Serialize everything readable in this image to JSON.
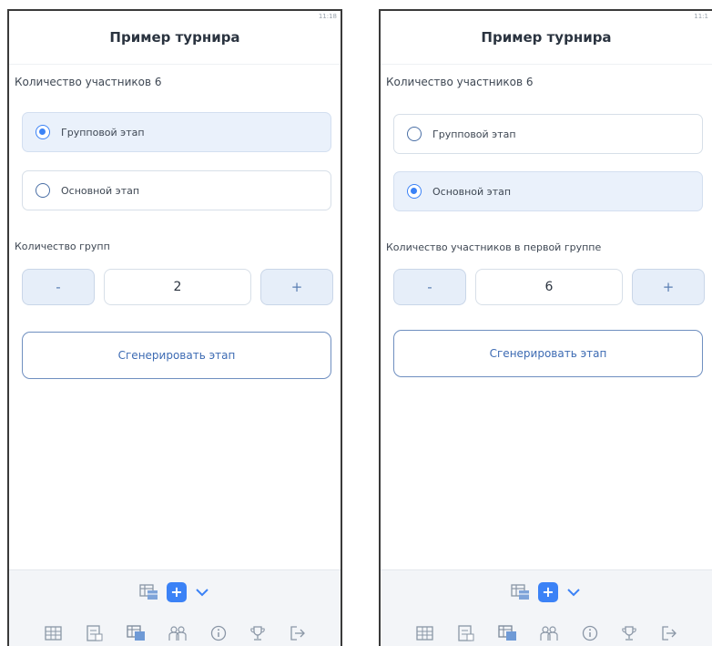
{
  "screens": [
    {
      "status_time": "11:18",
      "title": "Пример турнира",
      "participants_label": "Количество участников 6",
      "options": [
        {
          "label": "Групповой этап",
          "selected": true
        },
        {
          "label": "Основной этап",
          "selected": false
        }
      ],
      "stepper_label": "Количество групп",
      "stepper": {
        "minus": "-",
        "value": "2",
        "plus": "+"
      },
      "generate_label": "Сгенерировать этап"
    },
    {
      "status_time": "11:1",
      "title": "Пример турнира",
      "participants_label": "Количество участников 6",
      "options": [
        {
          "label": "Групповой этап",
          "selected": false
        },
        {
          "label": "Основной этап",
          "selected": true
        }
      ],
      "stepper_label": "Количество участников в первой группе",
      "stepper": {
        "minus": "-",
        "value": "6",
        "plus": "+"
      },
      "generate_label": "Сгенерировать этап"
    }
  ],
  "toolbar": {
    "top_icons": [
      "table-icon",
      "add-icon",
      "chevron-down-icon"
    ],
    "bottom_icons": [
      "grid-icon",
      "document-icon",
      "tables-icon",
      "users-icon",
      "info-icon",
      "trophy-icon",
      "logout-icon"
    ],
    "accent": "#3b82f6",
    "add_glyph": "+"
  }
}
